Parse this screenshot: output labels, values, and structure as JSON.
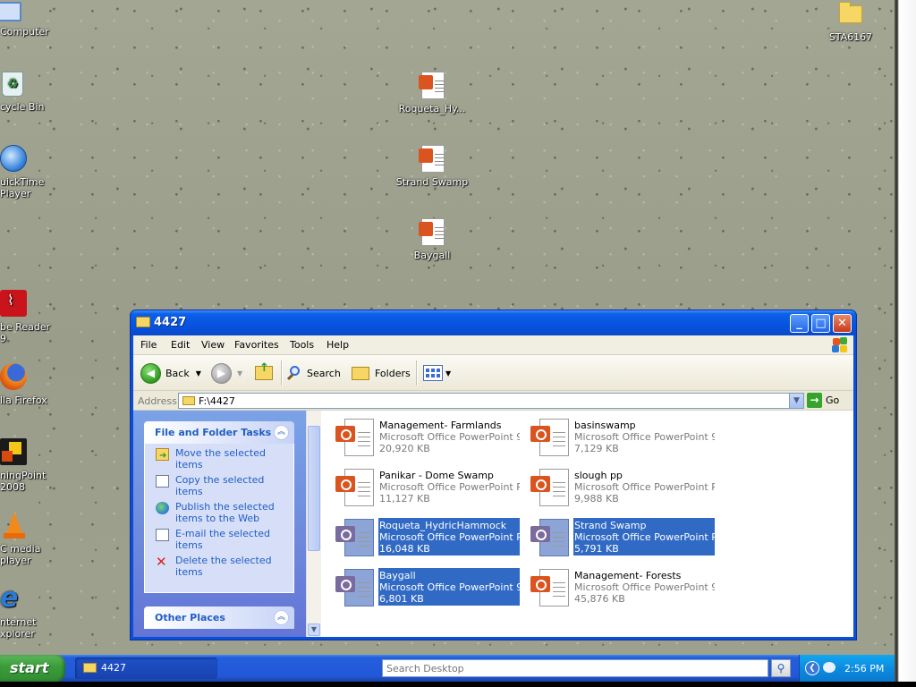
{
  "desktop": {
    "icons_left": [
      {
        "label": "Computer",
        "icon": "computer-icon"
      },
      {
        "label": "cycle Bin",
        "icon": "recycle-bin-icon"
      },
      {
        "label": "uickTime\nPlayer",
        "icon": "quicktime-icon"
      },
      {
        "label": "be Reader\n9",
        "icon": "adobe-reader-icon"
      },
      {
        "label": "lla Firefox",
        "icon": "firefox-icon"
      },
      {
        "label": "ningPoint\n2008",
        "icon": "learningpoint-icon"
      },
      {
        "label": "C media\nplayer",
        "icon": "vlc-icon"
      },
      {
        "label": "nternet\nxplorer",
        "icon": "internet-explorer-icon"
      }
    ],
    "icons_center": [
      {
        "label": "Roqueta_Hy...",
        "icon": "powerpoint-file-icon"
      },
      {
        "label": "Strand Swamp",
        "icon": "powerpoint-file-icon"
      },
      {
        "label": "Baygall",
        "icon": "powerpoint-file-icon"
      }
    ],
    "icon_right": {
      "label": "STA6167",
      "icon": "folder-icon"
    }
  },
  "window": {
    "title": "4427",
    "menu": [
      "File",
      "Edit",
      "View",
      "Favorites",
      "Tools",
      "Help"
    ],
    "toolbar": {
      "back": "Back",
      "search": "Search",
      "folders": "Folders"
    },
    "address": {
      "label": "Address",
      "value": "F:\\4427",
      "go": "Go"
    },
    "tasks_panel": {
      "title": "File and Folder Tasks",
      "items": [
        {
          "label": "Move the selected items",
          "icon": "move-icon"
        },
        {
          "label": "Copy the selected items",
          "icon": "copy-icon"
        },
        {
          "label": "Publish the selected items to the Web",
          "icon": "globe-icon"
        },
        {
          "label": "E-mail the selected items",
          "icon": "email-icon"
        },
        {
          "label": "Delete the selected items",
          "icon": "delete-x-icon"
        }
      ]
    },
    "other_places": {
      "title": "Other Places"
    },
    "files": [
      {
        "name": "Management- Farmlands",
        "type": "Microsoft Office PowerPoint 9...",
        "size": "20,920 KB",
        "selected": false
      },
      {
        "name": "basinswamp",
        "type": "Microsoft Office PowerPoint 9...",
        "size": "7,129 KB",
        "selected": false
      },
      {
        "name": "Panikar - Dome Swamp",
        "type": "Microsoft Office PowerPoint Pr...",
        "size": "11,127 KB",
        "selected": false
      },
      {
        "name": "slough pp",
        "type": "Microsoft Office PowerPoint Pr...",
        "size": "9,988 KB",
        "selected": false
      },
      {
        "name": "Roqueta_HydricHammock",
        "type": "Microsoft Office PowerPoint Pr...",
        "size": "16,048 KB",
        "selected": true
      },
      {
        "name": "Strand Swamp",
        "type": "Microsoft Office PowerPoint Pr...",
        "size": "5,791 KB",
        "selected": true
      },
      {
        "name": "Baygall",
        "type": "Microsoft Office PowerPoint 9...",
        "size": "6,801 KB",
        "selected": true
      },
      {
        "name": "Management- Forests",
        "type": "Microsoft Office PowerPoint 9...",
        "size": "45,876 KB",
        "selected": false
      }
    ]
  },
  "taskbar": {
    "start": "start",
    "task_window": "4427",
    "search_placeholder": "Search Desktop",
    "clock": "2:56 PM"
  },
  "colors": {
    "selection": "#316ac5",
    "titlebar": "#0753e0",
    "taskbar": "#245edb",
    "start": "#3c9e3c"
  }
}
